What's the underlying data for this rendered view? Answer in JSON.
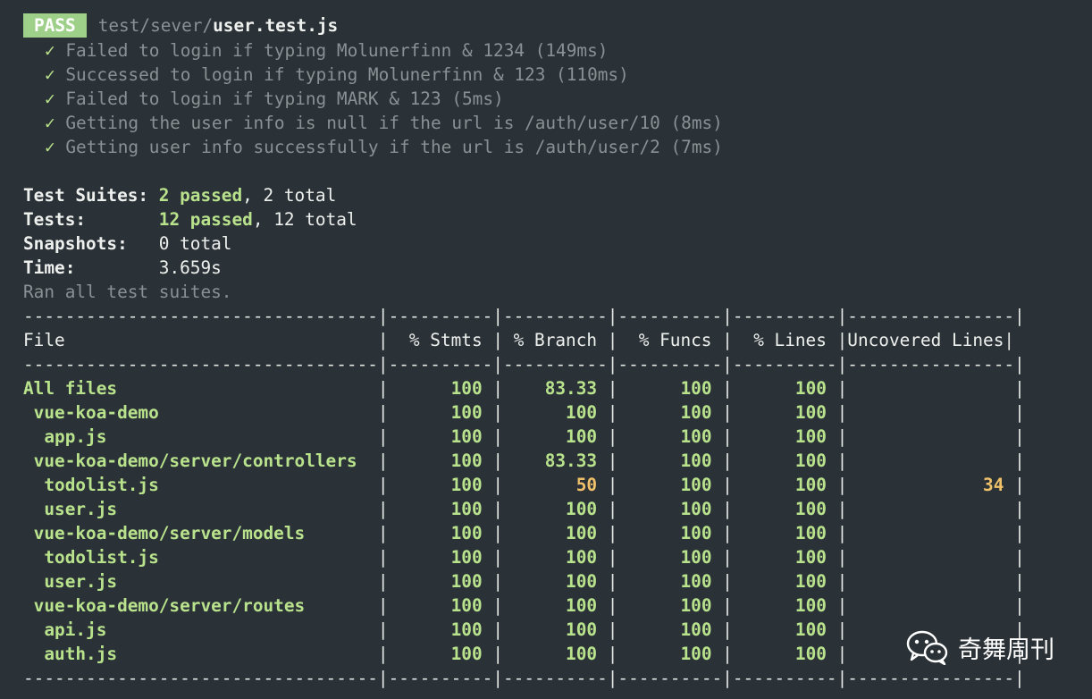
{
  "header": {
    "badge": "PASS",
    "path_dim": "test/sever/",
    "path_file": "user.test.js"
  },
  "tests": [
    {
      "check": "✓",
      "name": "Failed to login if typing Molunerfinn & 1234 (149ms)"
    },
    {
      "check": "✓",
      "name": "Successed to login if typing Molunerfinn & 123 (110ms)"
    },
    {
      "check": "✓",
      "name": "Failed to login if typing MARK & 123 (5ms)"
    },
    {
      "check": "✓",
      "name": "Getting the user info is null if the url is /auth/user/10 (8ms)"
    },
    {
      "check": "✓",
      "name": "Getting user info successfully if the url is /auth/user/2 (7ms)"
    }
  ],
  "summary": {
    "suites_label": "Test Suites: ",
    "suites_passed": "2 passed",
    "suites_total": ", 2 total",
    "tests_label": "Tests:       ",
    "tests_passed": "12 passed",
    "tests_total": ", 12 total",
    "snapshots_label": "Snapshots:   ",
    "snapshots_value": "0 total",
    "time_label": "Time:        ",
    "time_value": "3.659s",
    "ran": "Ran all test suites."
  },
  "coverage": {
    "separator": "----------------------------------|----------|----------|----------|----------|----------------|",
    "headers": [
      "File",
      "% Stmts",
      "% Branch",
      "% Funcs",
      "% Lines",
      "Uncovered Lines"
    ],
    "rows": [
      {
        "file": "All files",
        "indent": 0,
        "stmts": "100",
        "branch": "83.33",
        "funcs": "100",
        "lines": "100",
        "uncovered": ""
      },
      {
        "file": "vue-koa-demo",
        "indent": 1,
        "stmts": "100",
        "branch": "100",
        "funcs": "100",
        "lines": "100",
        "uncovered": ""
      },
      {
        "file": "app.js",
        "indent": 2,
        "stmts": "100",
        "branch": "100",
        "funcs": "100",
        "lines": "100",
        "uncovered": ""
      },
      {
        "file": "vue-koa-demo/server/controllers",
        "indent": 1,
        "stmts": "100",
        "branch": "83.33",
        "funcs": "100",
        "lines": "100",
        "uncovered": ""
      },
      {
        "file": "todolist.js",
        "indent": 2,
        "stmts": "100",
        "branch": "50",
        "funcs": "100",
        "lines": "100",
        "uncovered": "34",
        "warn": true
      },
      {
        "file": "user.js",
        "indent": 2,
        "stmts": "100",
        "branch": "100",
        "funcs": "100",
        "lines": "100",
        "uncovered": ""
      },
      {
        "file": "vue-koa-demo/server/models",
        "indent": 1,
        "stmts": "100",
        "branch": "100",
        "funcs": "100",
        "lines": "100",
        "uncovered": ""
      },
      {
        "file": "todolist.js",
        "indent": 2,
        "stmts": "100",
        "branch": "100",
        "funcs": "100",
        "lines": "100",
        "uncovered": ""
      },
      {
        "file": "user.js",
        "indent": 2,
        "stmts": "100",
        "branch": "100",
        "funcs": "100",
        "lines": "100",
        "uncovered": ""
      },
      {
        "file": "vue-koa-demo/server/routes",
        "indent": 1,
        "stmts": "100",
        "branch": "100",
        "funcs": "100",
        "lines": "100",
        "uncovered": ""
      },
      {
        "file": "api.js",
        "indent": 2,
        "stmts": "100",
        "branch": "100",
        "funcs": "100",
        "lines": "100",
        "uncovered": ""
      },
      {
        "file": "auth.js",
        "indent": 2,
        "stmts": "100",
        "branch": "100",
        "funcs": "100",
        "lines": "100",
        "uncovered": ""
      }
    ]
  },
  "watermark": {
    "text": "奇舞周刊",
    "icon": "wechat-icon"
  },
  "colors": {
    "background": "#2b3237",
    "pass_badge": "#9fd08a",
    "green": "#b9e28c",
    "dim": "#8a9194",
    "warning": "#f1c16a"
  }
}
